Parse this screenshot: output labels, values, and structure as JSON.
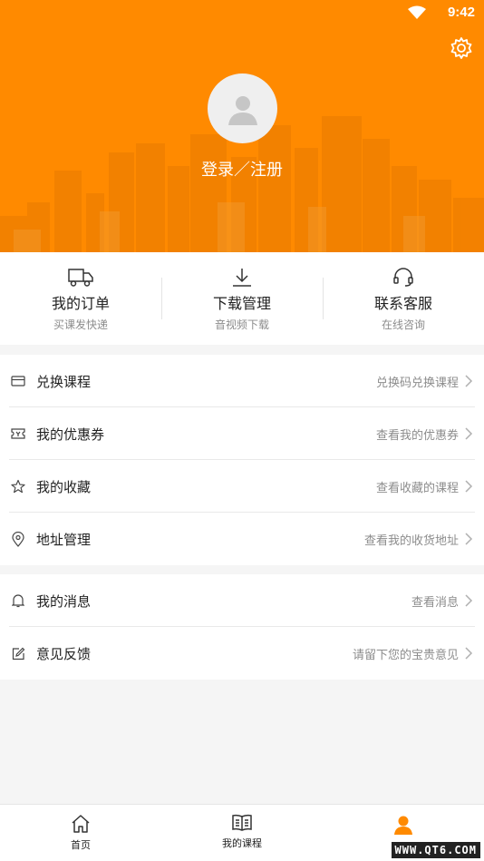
{
  "status_bar": {
    "time": "9:42"
  },
  "header": {
    "login_text": "登录／注册"
  },
  "quick_actions": [
    {
      "title": "我的订单",
      "subtitle": "买课发快递",
      "icon": "truck-icon"
    },
    {
      "title": "下载管理",
      "subtitle": "音视频下载",
      "icon": "download-icon"
    },
    {
      "title": "联系客服",
      "subtitle": "在线咨询",
      "icon": "headset-icon"
    }
  ],
  "menu_group_1": [
    {
      "label": "兑换课程",
      "hint": "兑换码兑换课程",
      "icon": "card-icon"
    },
    {
      "label": "我的优惠券",
      "hint": "查看我的优惠券",
      "icon": "coupon-icon"
    },
    {
      "label": "我的收藏",
      "hint": "查看收藏的课程",
      "icon": "star-icon"
    },
    {
      "label": "地址管理",
      "hint": "查看我的收货地址",
      "icon": "location-pin-icon"
    }
  ],
  "menu_group_2": [
    {
      "label": "我的消息",
      "hint": "查看消息",
      "icon": "bell-icon"
    },
    {
      "label": "意见反馈",
      "hint": "请留下您的宝贵意见",
      "icon": "edit-icon"
    }
  ],
  "bottom_nav": [
    {
      "label": "首页",
      "icon": "home-icon",
      "active": false
    },
    {
      "label": "我的课程",
      "icon": "book-icon",
      "active": false
    },
    {
      "label": "",
      "icon": "user-icon",
      "active": true
    }
  ],
  "watermark": "WWW.QT6.COM",
  "colors": {
    "accent": "#ff8a00",
    "text": "#222222",
    "hint": "#8c8c8c"
  }
}
